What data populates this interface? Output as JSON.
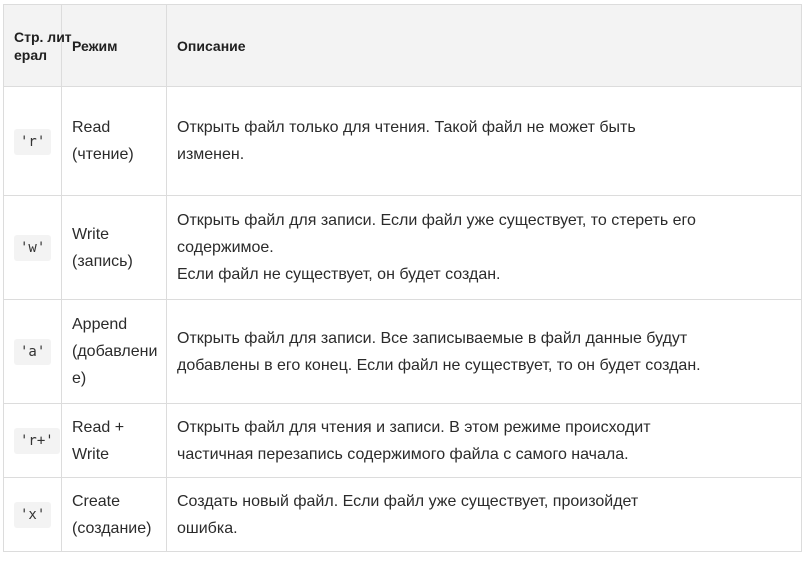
{
  "headers": {
    "literal": "Стр. лит ерал",
    "mode": "Режим",
    "description": "Описание"
  },
  "rows": [
    {
      "literal": "'r'",
      "mode": [
        "Read",
        "(чтение)"
      ],
      "description": [
        "Открыть файл только для чтения. Такой файл не может быть",
        "изменен."
      ]
    },
    {
      "literal": "'w'",
      "mode": [
        "Write",
        "(запись)"
      ],
      "description": [
        "Открыть файл для записи. Если файл уже существует, то стереть его",
        "содержимое.",
        "Если файл не существует, он будет создан."
      ]
    },
    {
      "literal": "'a'",
      "mode": [
        "Append",
        "(добавлени",
        "е)"
      ],
      "description": [
        "Открыть файл для записи. Все записываемые в файл данные будут",
        "добавлены в его конец. Если файл не существует, то он будет создан."
      ]
    },
    {
      "literal": "'r+'",
      "mode": [
        "Read + Write"
      ],
      "description": [
        "Открыть файл для чтения и записи. В этом режиме происходит",
        "частичная перезапись содержимого файла с самого начала."
      ]
    },
    {
      "literal": "'x'",
      "mode": [
        "Create",
        "(создание)"
      ],
      "description": [
        "Создать новый файл. Если файл уже существует, произойдет",
        "ошибка."
      ]
    }
  ]
}
